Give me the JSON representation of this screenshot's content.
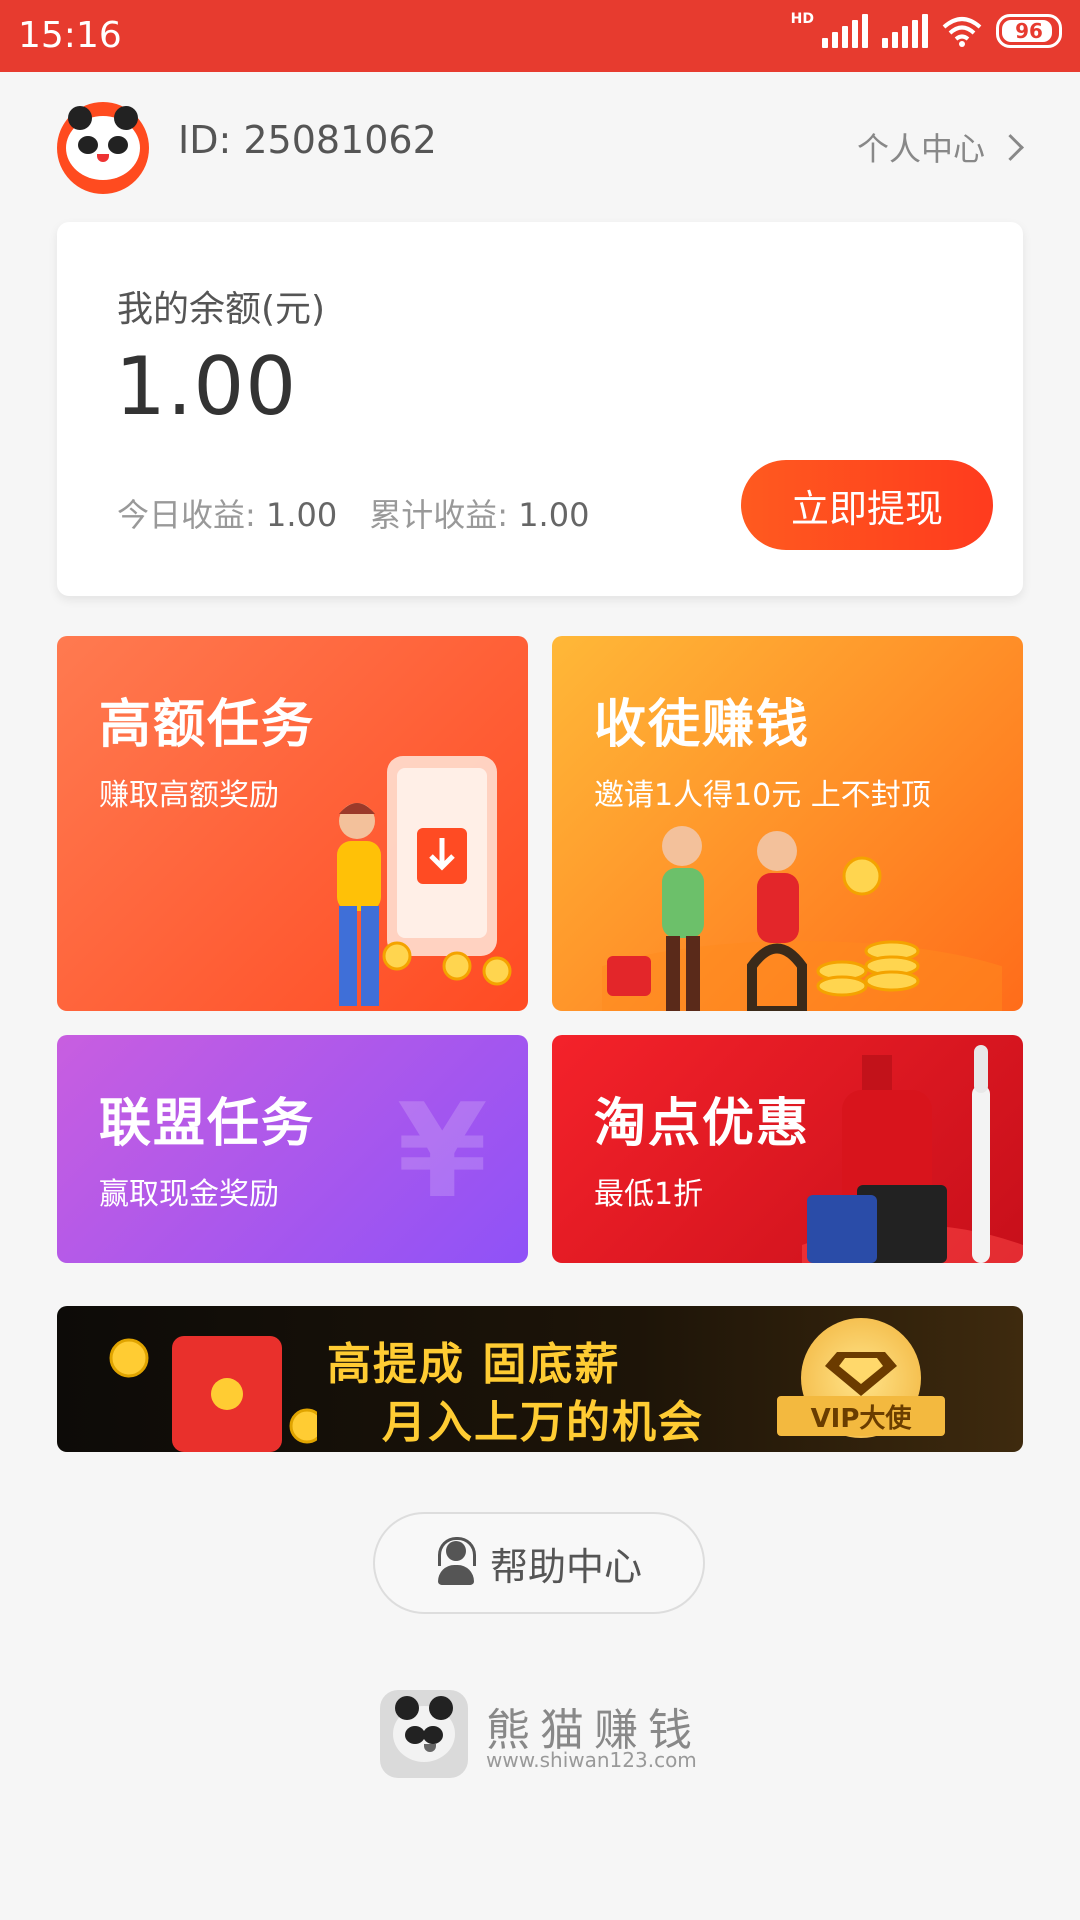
{
  "status_bar": {
    "time": "15:16",
    "network_badge": "HD",
    "battery": "96"
  },
  "header": {
    "user_id": "ID: 25081062",
    "personal_center": "个人中心"
  },
  "balance": {
    "label": "我的余额(元)",
    "value": "1.00",
    "today_label": "今日收益:",
    "today_value": "1.00",
    "total_label": "累计收益:",
    "total_value": "1.00",
    "withdraw_button": "立即提现"
  },
  "tiles": [
    {
      "title": "高额任务",
      "subtitle": "赚取高额奖励"
    },
    {
      "title": "收徒赚钱",
      "subtitle": "邀请1人得10元 上不封顶"
    },
    {
      "title": "联盟任务",
      "subtitle": "赢取现金奖励"
    },
    {
      "title": "淘点优惠",
      "subtitle": "最低1折"
    }
  ],
  "banner": {
    "line1": "高提成 固底薪",
    "line2": "月入上万的机会",
    "badge": "VIP大使"
  },
  "help_button": "帮助中心",
  "brand": {
    "name": "熊猫赚钱",
    "url": "www.shiwan123.com"
  },
  "colors": {
    "accent": "#e73b2f",
    "button": "#ff4b1f"
  }
}
